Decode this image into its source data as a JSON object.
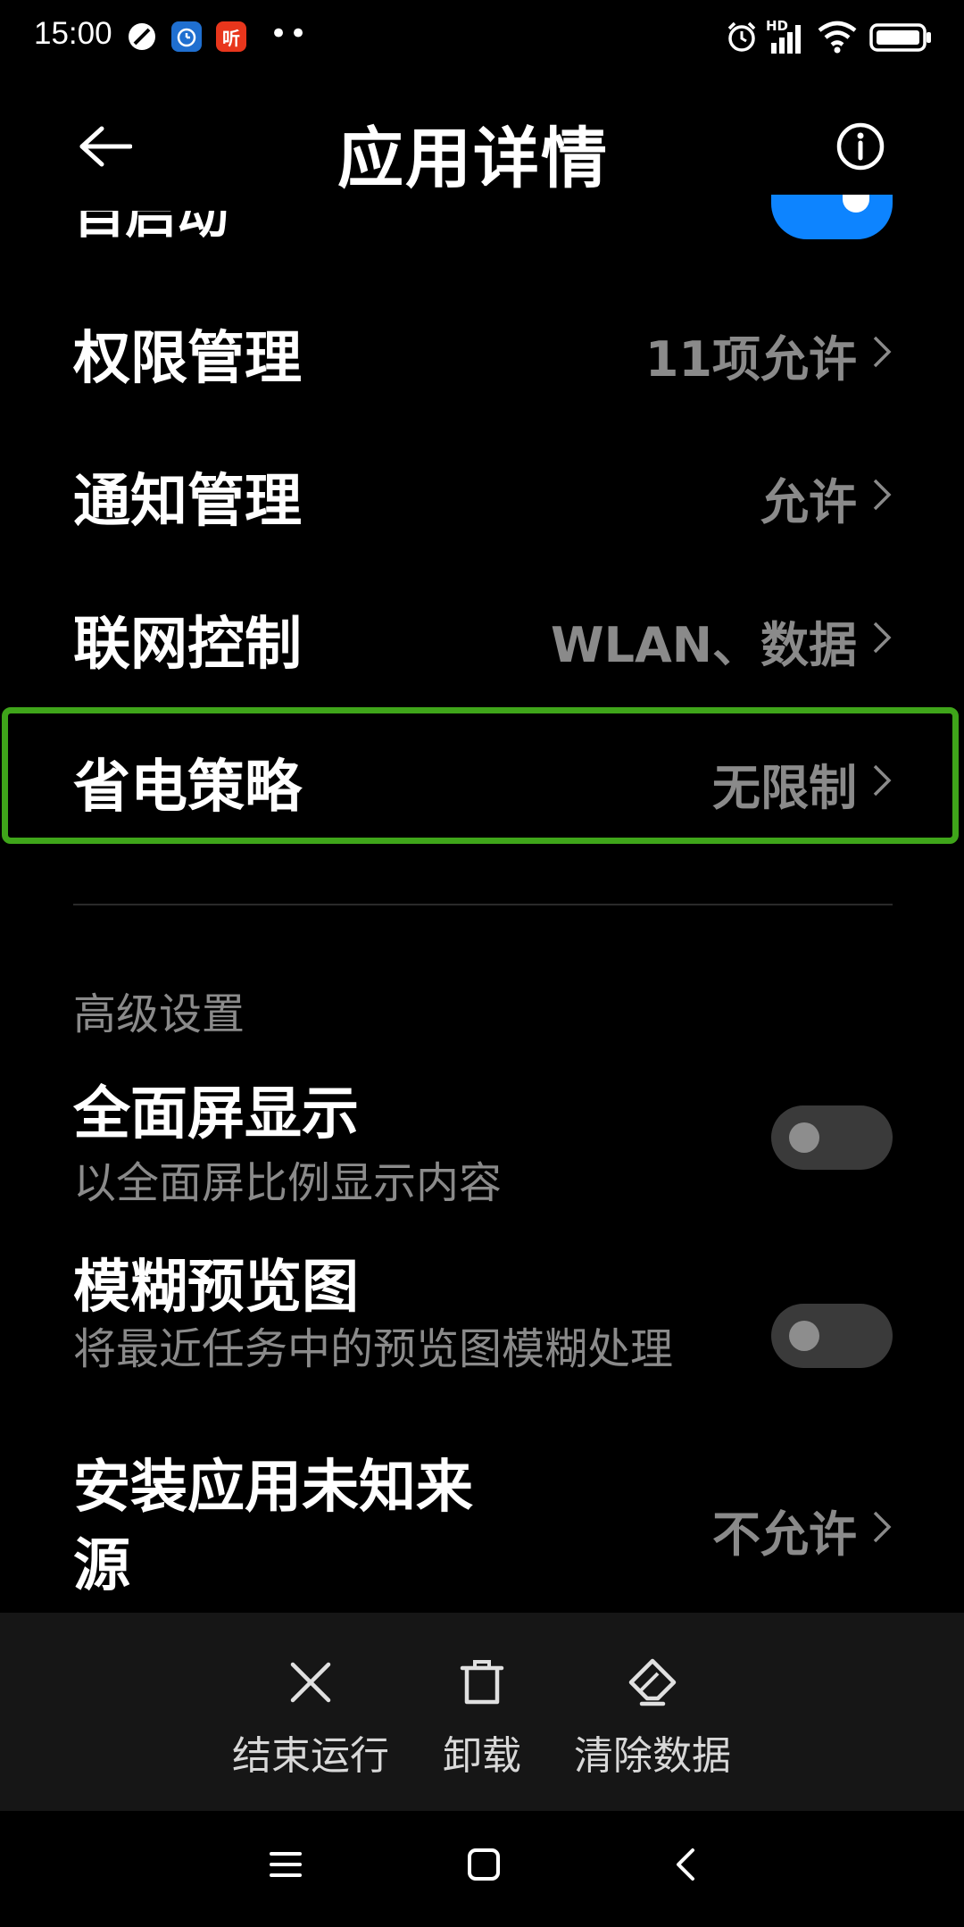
{
  "status_bar": {
    "time": "15:00",
    "badge_app": "听",
    "dots": "••",
    "hd_label": "HD",
    "icons": [
      "no-disturb-icon",
      "alarm-app-icon",
      "listen-app-icon",
      "alarm-clock-icon",
      "signal-icon",
      "wifi-icon",
      "battery-icon"
    ]
  },
  "header": {
    "title": "应用详情"
  },
  "cut_row": {
    "label": "自启动"
  },
  "rows": [
    {
      "label": "权限管理",
      "value": "11项允许"
    },
    {
      "label": "通知管理",
      "value": "允许"
    },
    {
      "label": "联网控制",
      "value": "WLAN、数据"
    },
    {
      "label": "省电策略",
      "value": "无限制"
    }
  ],
  "section": {
    "title": "高级设置"
  },
  "toggles": [
    {
      "title": "全面屏显示",
      "subtitle": "以全面屏比例显示内容"
    },
    {
      "title": "模糊预览图",
      "subtitle": "将最近任务中的预览图模糊处理"
    }
  ],
  "unknown_sources": {
    "label": "安装应用未知来源",
    "value": "不允许"
  },
  "actions": [
    {
      "label": "结束运行"
    },
    {
      "label": "卸载"
    },
    {
      "label": "清除数据"
    }
  ],
  "colors": {
    "highlight": "#3fa51a",
    "accent": "#0d84ff",
    "secondary_text": "#8a8a8a"
  }
}
